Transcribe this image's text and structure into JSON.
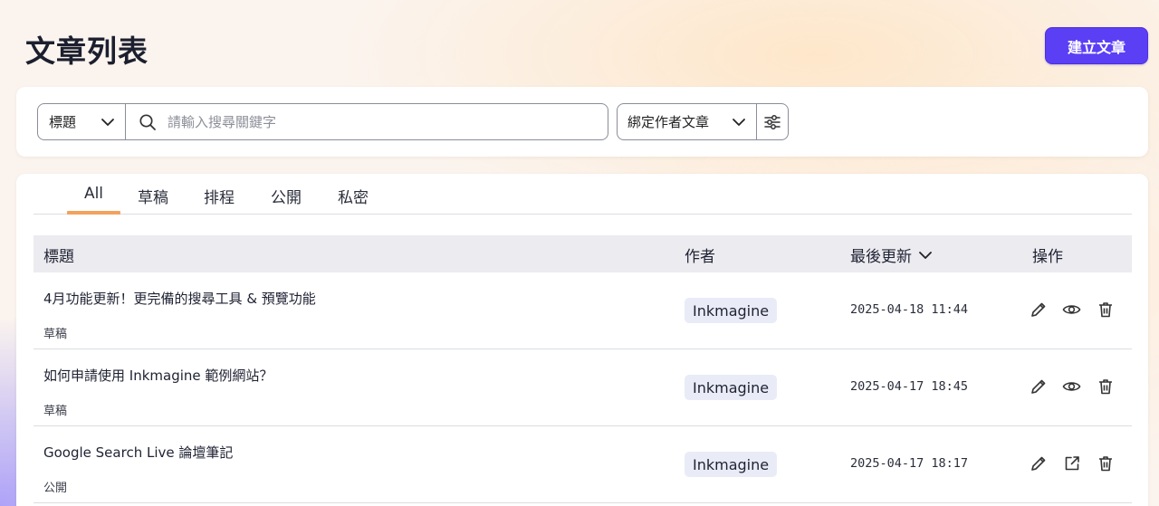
{
  "header": {
    "title": "文章列表",
    "create_button": "建立文章"
  },
  "filters": {
    "field_select": "標題",
    "search_placeholder": "請輸入搜尋關鍵字",
    "author_select": "綁定作者文章"
  },
  "tabs": [
    {
      "label": "All",
      "active": true
    },
    {
      "label": "草稿",
      "active": false
    },
    {
      "label": "排程",
      "active": false
    },
    {
      "label": "公開",
      "active": false
    },
    {
      "label": "私密",
      "active": false
    }
  ],
  "table": {
    "columns": {
      "title": "標題",
      "author": "作者",
      "updated": "最後更新",
      "actions": "操作"
    },
    "sort_icon": "chevron-down-icon",
    "rows": [
      {
        "title": "4月功能更新！更完備的搜尋工具 & 預覽功能",
        "status": "草稿",
        "author": "Inkmagine",
        "updated": "2025-04-18 11:44",
        "actions": [
          "edit-icon",
          "preview-icon",
          "delete-icon"
        ]
      },
      {
        "title": "如何申請使用 Inkmagine 範例網站？",
        "status": "草稿",
        "author": "Inkmagine",
        "updated": "2025-04-17 18:45",
        "actions": [
          "edit-icon",
          "preview-icon",
          "delete-icon"
        ]
      },
      {
        "title": "Google Search Live 論壇筆記",
        "status": "公開",
        "author": "Inkmagine",
        "updated": "2025-04-17 18:17",
        "actions": [
          "edit-icon",
          "external-link-icon",
          "delete-icon"
        ]
      }
    ]
  },
  "colors": {
    "primary": "#5b3ff5",
    "tab_indicator": "#f2a25c",
    "author_chip_bg": "#e9ecf7",
    "table_header_bg": "#ebebf0"
  }
}
